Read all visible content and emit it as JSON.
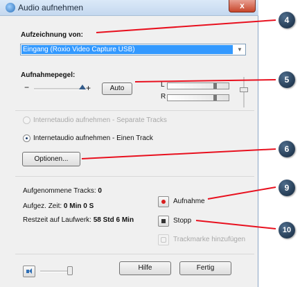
{
  "window": {
    "title": "Audio aufnehmen",
    "close_label": "x"
  },
  "source": {
    "label": "Aufzeichnung von:",
    "selected": "Eingang (Roxio Video Capture USB)",
    "arrow": "▼"
  },
  "level": {
    "label": "Aufnahmepegel:",
    "minus": "−",
    "plus": "+",
    "auto_label": "Auto",
    "left_channel": "L",
    "right_channel": "R"
  },
  "internet": {
    "separate_tracks": "Internetaudio aufnehmen - Separate Tracks",
    "one_track": "Internetaudio aufnehmen - Einen Track",
    "options_label": "Optionen..."
  },
  "stats": {
    "tracks_label": "Aufgenommene Tracks:",
    "tracks_value": "0",
    "time_label": "Aufgez. Zeit:",
    "time_value": "0 Min 0 S",
    "remaining_label": "Restzeit auf Laufwerk:",
    "remaining_value": "58 Std 6 Min"
  },
  "controls": {
    "record_label": "Aufnahme",
    "stop_label": "Stopp",
    "marker_label": "Trackmarke hinzufügen"
  },
  "footer": {
    "help_label": "Hilfe",
    "done_label": "Fertig"
  },
  "callouts": [
    "4",
    "5",
    "6",
    "9",
    "10"
  ],
  "colors": {
    "callout_line": "#e8101e",
    "selection": "#3399ff",
    "record": "#d81e1e"
  }
}
